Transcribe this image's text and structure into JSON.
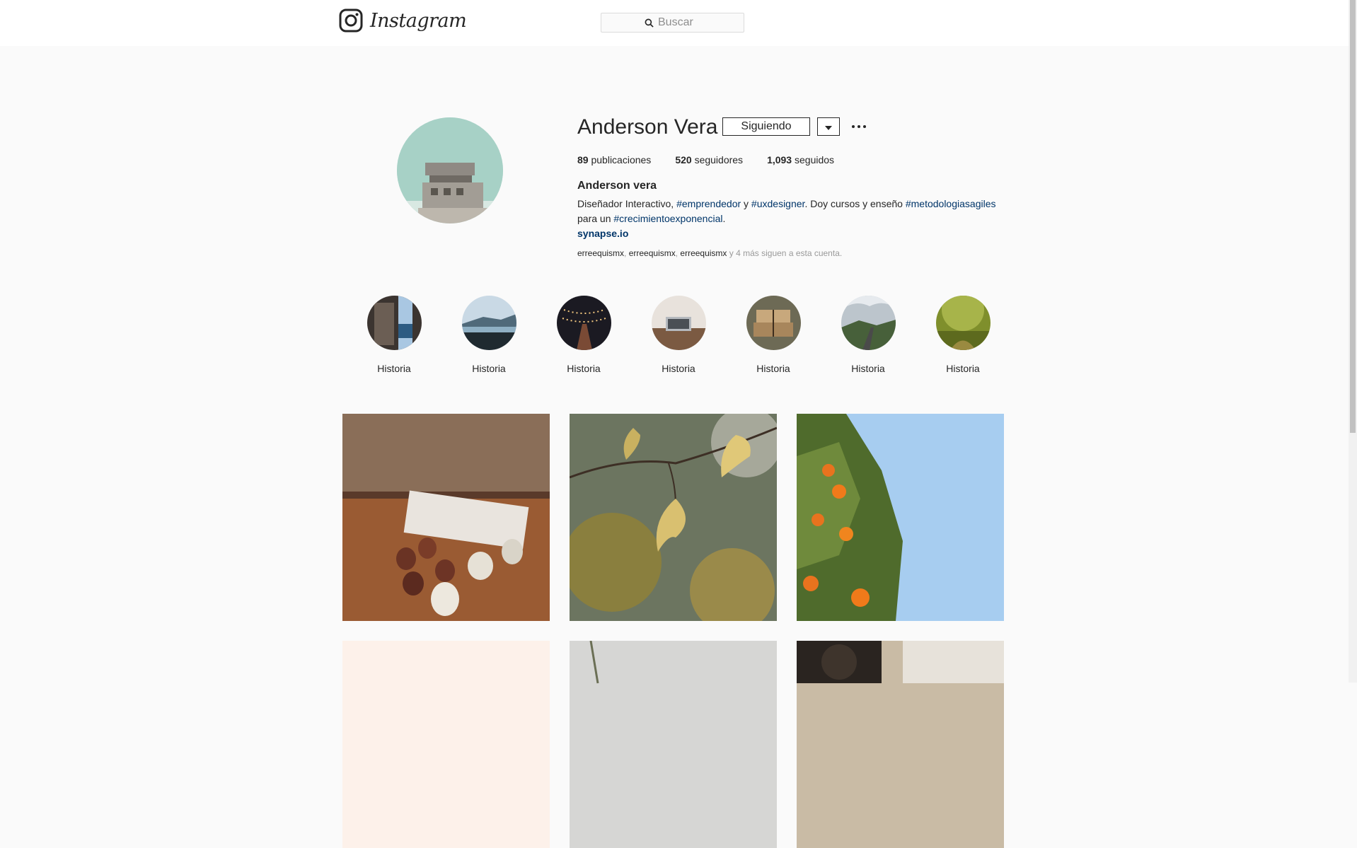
{
  "nav": {
    "brand": "Instagram",
    "search_placeholder": "Buscar"
  },
  "profile": {
    "username": "Anderson Vera",
    "follow_button": "Siguiendo",
    "stats": [
      {
        "count": "89",
        "label": "publicaciones"
      },
      {
        "count": "520",
        "label": "seguidores"
      },
      {
        "count": "1,093",
        "label": "seguidos"
      }
    ],
    "full_name": "Anderson vera",
    "bio": {
      "t1": "Diseñador Interactivo, ",
      "h1": "#emprendedor",
      "t2": " y ",
      "h2": "#uxdesigner",
      "t3": ". Doy cursos y enseño ",
      "h3": "#metodologiasagiles",
      "t4": "para un ",
      "h4": "#crecimientoexponencial",
      "t5": "."
    },
    "website": "synapse.io",
    "followed_by": {
      "a1": "erreequismx",
      "sep1": ", ",
      "a2": "erreequismx",
      "sep2": ", ",
      "a3": "erreequismx",
      "rest": " y 4 más siguen a esta cuenta."
    }
  },
  "stories": [
    {
      "label": "Historia"
    },
    {
      "label": "Historia"
    },
    {
      "label": "Historia"
    },
    {
      "label": "Historia"
    },
    {
      "label": "Historia"
    },
    {
      "label": "Historia"
    },
    {
      "label": "Historia"
    }
  ],
  "colors": {
    "hashtag": "#003569",
    "text": "#262626",
    "muted": "#999999",
    "page_bg": "#fafafa"
  }
}
